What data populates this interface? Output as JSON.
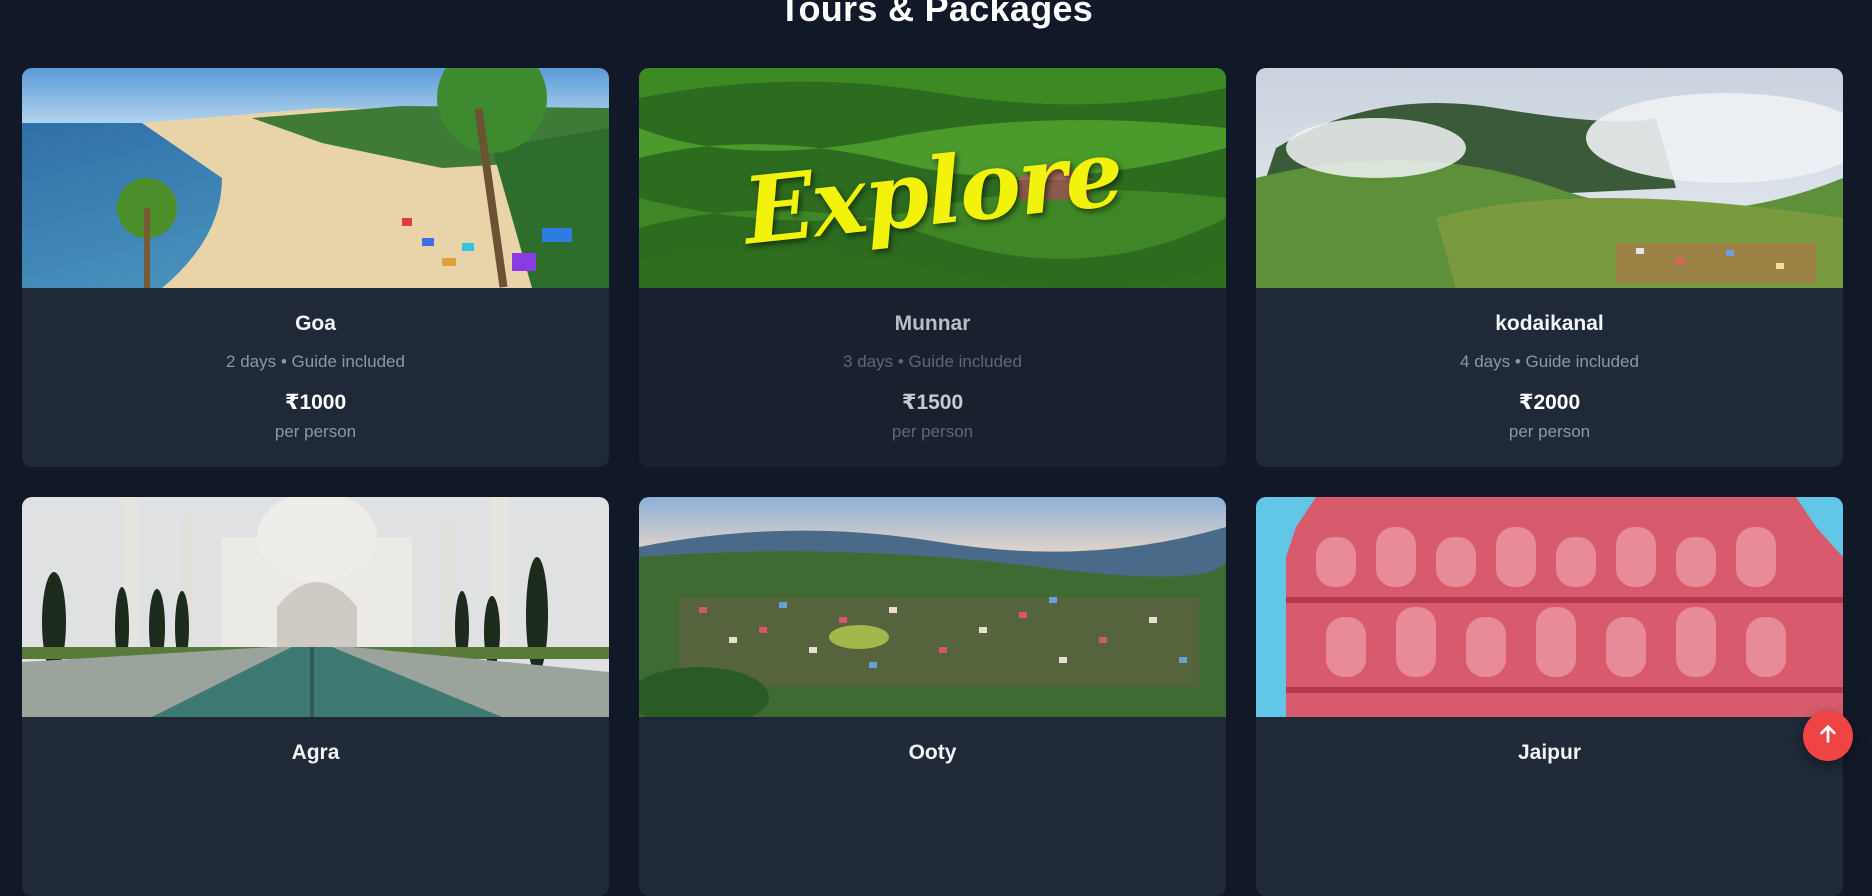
{
  "page": {
    "section_title": "Tours & Packages"
  },
  "tours": [
    {
      "name": "Goa",
      "meta": "2 days • Guide included",
      "price": "₹1000",
      "per": "per person"
    },
    {
      "name": "Munnar",
      "meta": "3 days • Guide included",
      "price": "₹1500",
      "per": "per person",
      "overlay_text": "Explore"
    },
    {
      "name": "kodaikanal",
      "meta": "4 days • Guide included",
      "price": "₹2000",
      "per": "per person"
    },
    {
      "name": "Agra"
    },
    {
      "name": "Ooty"
    },
    {
      "name": "Jaipur"
    }
  ],
  "scroll_top": {
    "icon": "arrow-up-icon",
    "color": "#ef4444"
  },
  "colors": {
    "background": "#111827",
    "card": "#1f2937"
  }
}
